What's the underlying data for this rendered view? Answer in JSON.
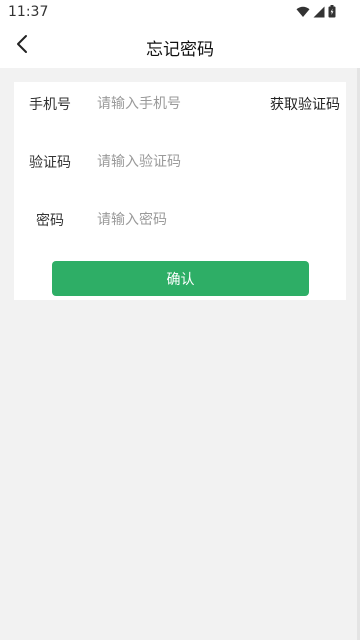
{
  "status_bar": {
    "time": "11:37",
    "icons": [
      "wifi-icon",
      "signal-icon",
      "battery-icon"
    ]
  },
  "header": {
    "title": "忘记密码",
    "back_icon": "back-chevron-icon"
  },
  "form": {
    "phone": {
      "label": "手机号",
      "placeholder": "请输入手机号",
      "value": ""
    },
    "get_code_label": "获取验证码",
    "code": {
      "label": "验证码",
      "placeholder": "请输入验证码",
      "value": ""
    },
    "password": {
      "label": "密码",
      "placeholder": "请输入密码",
      "value": ""
    },
    "confirm_label": "确认"
  },
  "colors": {
    "accent": "#2eae66",
    "background": "#f2f2f2",
    "card": "#ffffff"
  }
}
